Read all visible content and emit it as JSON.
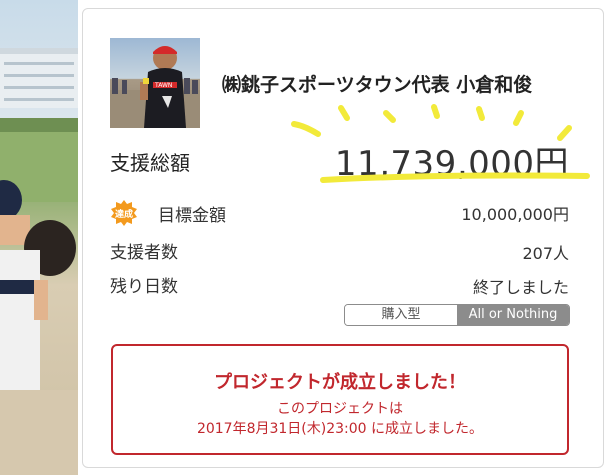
{
  "owner": {
    "name": "㈱銚子スポーツタウン代表 小倉和俊",
    "photo_shirt_text": "TAWN"
  },
  "funding": {
    "label": "支援総額",
    "amount": "11,739,000円",
    "highlight_color": "#f2ea3a"
  },
  "stats": [
    {
      "label": "目標金額",
      "value": "10,000,000円",
      "badge": "達成"
    },
    {
      "label": "支援者数",
      "value": "207人"
    },
    {
      "label": "残り日数",
      "value": "終了しました"
    }
  ],
  "type_toggle": {
    "option1": "購入型",
    "option2": "All or Nothing",
    "selected": "All or Nothing"
  },
  "success": {
    "title": "プロジェクトが成立しました！",
    "line1": "このプロジェクトは",
    "line2": "2017年8月31日(木)23:00 に成立しました。",
    "color": "#c1272d"
  },
  "colors": {
    "accent_badge": "#f39a1e",
    "toggle_active": "#8c8c8c"
  }
}
